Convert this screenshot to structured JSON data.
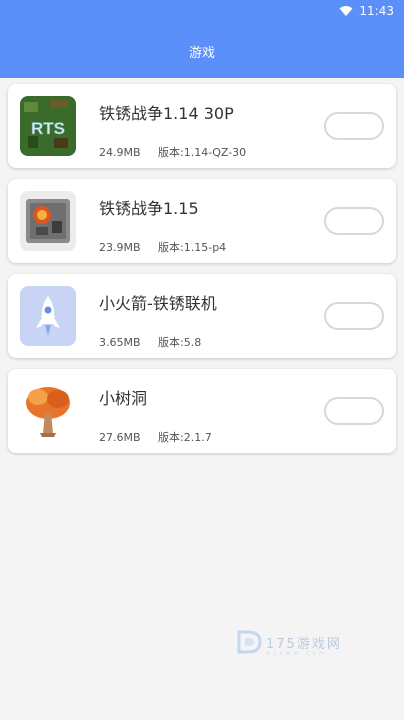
{
  "status_bar": {
    "time": "11:43"
  },
  "app_bar": {
    "title": "游戏"
  },
  "apps": [
    {
      "name": "铁锈战争1.14 30P",
      "size": "24.9MB",
      "version": "版本:1.14-QZ-30"
    },
    {
      "name": "铁锈战争1.15",
      "size": "23.9MB",
      "version": "版本:1.15-p4"
    },
    {
      "name": "小火箭-铁锈联机",
      "size": "3.65MB",
      "version": "版本:5.8"
    },
    {
      "name": "小树洞",
      "size": "27.6MB",
      "version": "版本:2.1.7"
    }
  ],
  "watermark": {
    "text": "175游戏网",
    "sub": "x1xww.com"
  },
  "colors": {
    "primary": "#5b8ff9",
    "background": "#f4f4f4"
  }
}
